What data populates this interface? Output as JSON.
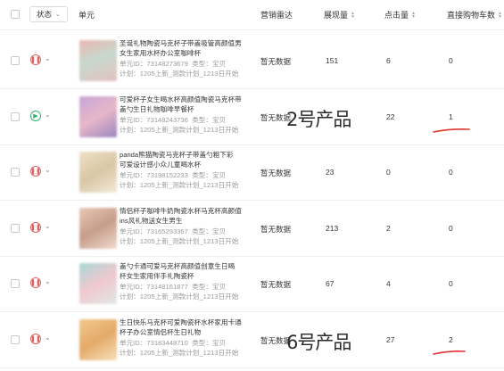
{
  "header": {
    "status_label": "状态",
    "col_unit": "单元",
    "col_radar": "营销雷达",
    "col_impressions": "展现量",
    "col_clicks": "点击量",
    "col_direct_cart": "直接购物车数"
  },
  "rows": [
    {
      "status_icon": "pause-icon",
      "title1": "圣诞礼物陶瓷马克杯子带盖吸管高颜值男",
      "title2": "女生家用水杯办公室咖啡杯",
      "unit_id": "单元ID：73148273679",
      "type": "类型：宝贝",
      "plan": "计划：1205上新_测款计划_1213日开始",
      "radar": "暂无数据",
      "impressions": "151",
      "clicks": "6",
      "cart": "0"
    },
    {
      "status_icon": "play-icon",
      "title1": "可爱杯子女生喝水杯高颜值陶瓷马克杯带",
      "title2": "盖勺生日礼物咖啡早餐杯",
      "unit_id": "单元ID：73148243736",
      "type": "类型：宝贝",
      "plan": "计划：1205上新_测款计划_1213日开始",
      "radar": "暂无数据",
      "impressions": "2号产品",
      "clicks": "22",
      "cart": "1"
    },
    {
      "status_icon": "pause-icon",
      "title1": "panda熊猫陶瓷马克杯子带盖勺粗下彩",
      "title2": "可爱设计感小众儿童喝水杯",
      "unit_id": "单元ID：73198152233",
      "type": "类型：宝贝",
      "plan": "计划：1205上新_测款计划_1213日开始",
      "radar": "暂无数据",
      "impressions": "23",
      "clicks": "0",
      "cart": "0"
    },
    {
      "status_icon": "pause-icon",
      "title1": "情侣杯子咖啡牛奶陶瓷水杯马克杯高颜值",
      "title2": "ins风礼物送女生男生",
      "unit_id": "单元ID：73165293367",
      "type": "类型：宝贝",
      "plan": "计划：1205上新_测款计划_1213日开始",
      "radar": "暂无数据",
      "impressions": "213",
      "clicks": "2",
      "cart": "0"
    },
    {
      "status_icon": "pause-icon",
      "title1": "盖勺卡通可爱马克杯高颜值创意生日喝",
      "title2": "杯女生家用伴手礼陶瓷杯",
      "unit_id": "单元ID：73148161877",
      "type": "类型：宝贝",
      "plan": "计划：1205上新_测款计划_1213日开始",
      "radar": "暂无数据",
      "impressions": "67",
      "clicks": "4",
      "cart": "0"
    },
    {
      "status_icon": "pause-icon",
      "title1": "生日快乐马克杯可爱陶瓷杯水杯家用卡通",
      "title2": "杯子办公室情侣杯生日礼物",
      "unit_id": "单元ID：73183448710",
      "type": "类型：宝贝",
      "plan": "计划：1205上新_测款计划_1213日开始",
      "radar": "暂无数据",
      "impressions": "6号产品",
      "clicks": "27",
      "cart": "2"
    }
  ],
  "annotations": {
    "note_row2": "2号产品",
    "note_row6": "6号产品"
  },
  "colors": {
    "pause": "#e06060",
    "play": "#2db36b",
    "underline": "#e0342f"
  }
}
